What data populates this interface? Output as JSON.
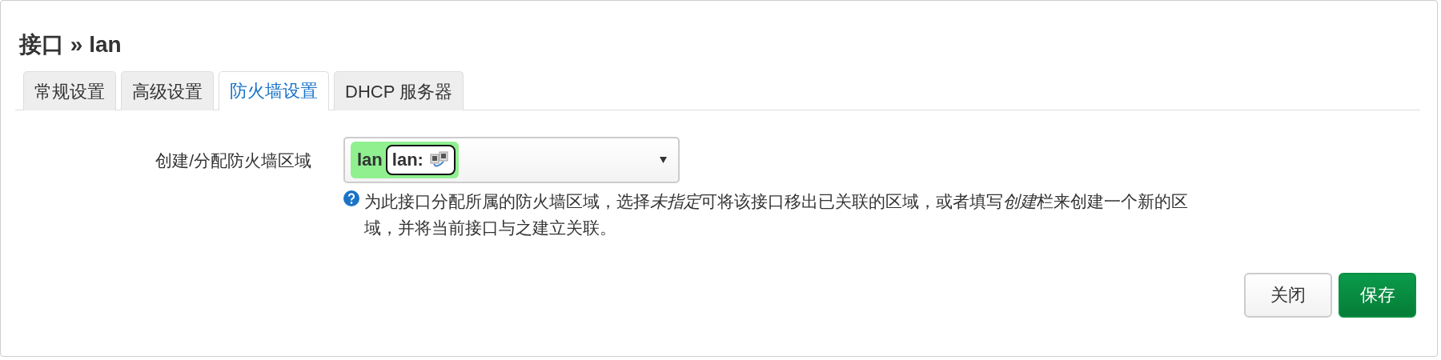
{
  "modal": {
    "title": "接口 » lan"
  },
  "tabs": [
    {
      "label": "常规设置",
      "selected": false
    },
    {
      "label": "高级设置",
      "selected": false
    },
    {
      "label": "防火墙设置",
      "selected": true
    },
    {
      "label": "DHCP 服务器",
      "selected": false
    }
  ],
  "field": {
    "label": "创建/分配防火墙区域",
    "zone": {
      "name": "lan",
      "color": "#90f090",
      "badge": "lan:"
    },
    "help": [
      {
        "text": "为此接口分配所属的防火墙区域，选择",
        "italic": false
      },
      {
        "text": "未指定",
        "italic": true
      },
      {
        "text": "可将该接口移出已关联的区域，或者填写",
        "italic": false
      },
      {
        "text": "创建",
        "italic": true
      },
      {
        "text": "栏来创建一个新的区域，并将当前接口与之建立关联。",
        "italic": false
      }
    ]
  },
  "buttons": [
    {
      "label": "关闭",
      "kind": "secondary"
    },
    {
      "label": "保存",
      "kind": "primary"
    }
  ]
}
